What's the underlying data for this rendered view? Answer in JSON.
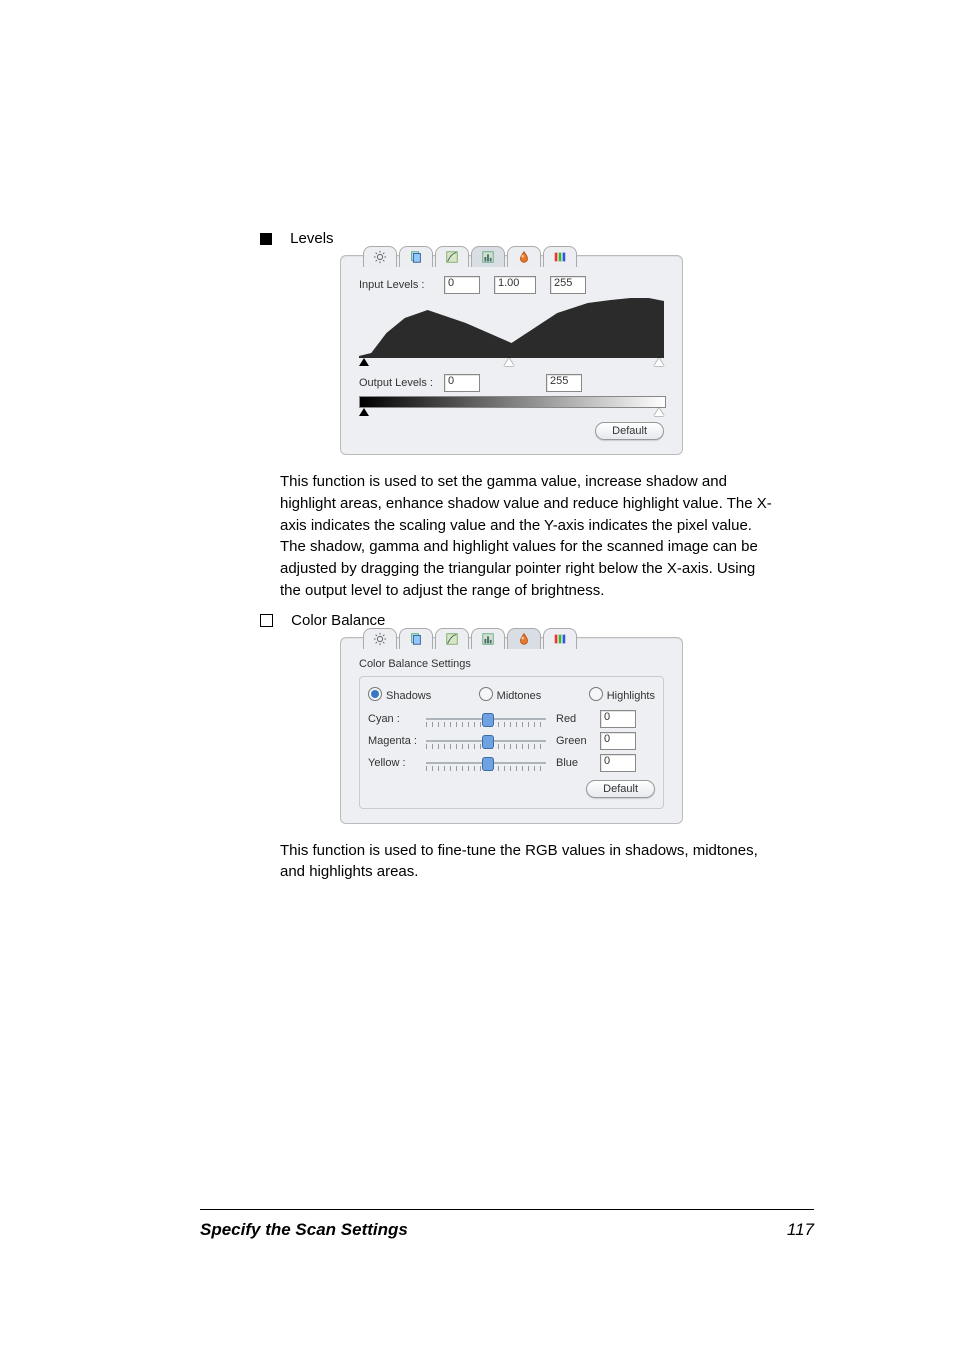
{
  "section1": {
    "title": "Levels"
  },
  "levels": {
    "input_label": "Input Levels :",
    "output_label": "Output Levels :",
    "in_lo": "0",
    "in_gamma": "1.00",
    "in_hi": "255",
    "out_lo": "0",
    "out_hi": "255",
    "default_btn": "Default"
  },
  "para1": "This function is used to set the gamma value, increase shadow and highlight areas, enhance shadow value and reduce highlight value. The X-axis indicates the scaling value and the Y-axis indicates the pixel value. The shadow, gamma and highlight values for the scanned image can be adjusted by dragging the triangular pointer right below the X-axis. Using the output level to adjust the range of brightness.",
  "section2": {
    "title": "Color Balance"
  },
  "cb": {
    "heading": "Color Balance Settings",
    "r1": "Shadows",
    "r2": "Midtones",
    "r3": "Highlights",
    "rows": [
      {
        "left": "Cyan :",
        "right": "Red",
        "val": "0"
      },
      {
        "left": "Magenta :",
        "right": "Green",
        "val": "0"
      },
      {
        "left": "Yellow :",
        "right": "Blue",
        "val": "0"
      }
    ],
    "default_btn": "Default"
  },
  "para2": "This function is used to fine-tune the RGB values in shadows, midtones, and highlights areas.",
  "footer": {
    "title": "Specify the Scan Settings",
    "page": "117"
  },
  "icons": {
    "brightness": "brightness-icon",
    "page": "page-hue-icon",
    "curve": "curve-icon",
    "hist": "histogram-icon",
    "drop": "color-drop-icon",
    "hsl": "hsl-icon"
  }
}
